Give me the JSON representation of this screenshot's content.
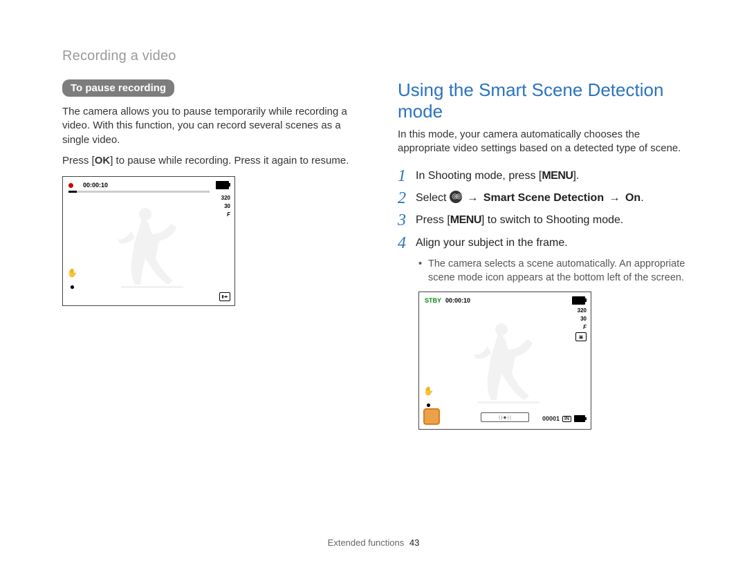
{
  "header": "Recording a video",
  "left": {
    "pill": "To pause recording",
    "intro": "The camera allows you to pause temporarily while recording a video. With this function, you can record several scenes as a single video.",
    "press_prefix": "Press [",
    "press_button": "OK",
    "press_suffix": "] to pause while recording. Press it again to resume.",
    "lcd": {
      "timecode": "00:00:10",
      "res": "320",
      "fps": "30",
      "fps_unit": "F"
    }
  },
  "right": {
    "title": "Using the Smart Scene Detection mode",
    "intro": "In this mode, your camera automatically chooses the appropriate video settings based on a detected type of scene.",
    "steps": {
      "s1": {
        "num": "1",
        "prefix": "In Shooting mode, press [",
        "btn": "MENU",
        "suffix": "]."
      },
      "s2": {
        "num": "2",
        "prefix": "Select ",
        "mid": " → ",
        "bold1": "Smart Scene Detection",
        "bold2": "On",
        "suffix": "."
      },
      "s3": {
        "num": "3",
        "prefix": "Press [",
        "btn": "MENU",
        "suffix": "] to switch to Shooting mode."
      },
      "s4": {
        "num": "4",
        "text": "Align your subject in the frame."
      }
    },
    "substep": "The camera selects a scene automatically. An appropriate scene mode icon appears at the bottom left of the screen.",
    "lcd": {
      "stby": "STBY",
      "timecode": "00:00:10",
      "res": "320",
      "fps": "30",
      "fps_unit": "F",
      "counter": "00001",
      "in_label": "IN"
    }
  },
  "footer": {
    "section": "Extended functions",
    "page": "43"
  }
}
